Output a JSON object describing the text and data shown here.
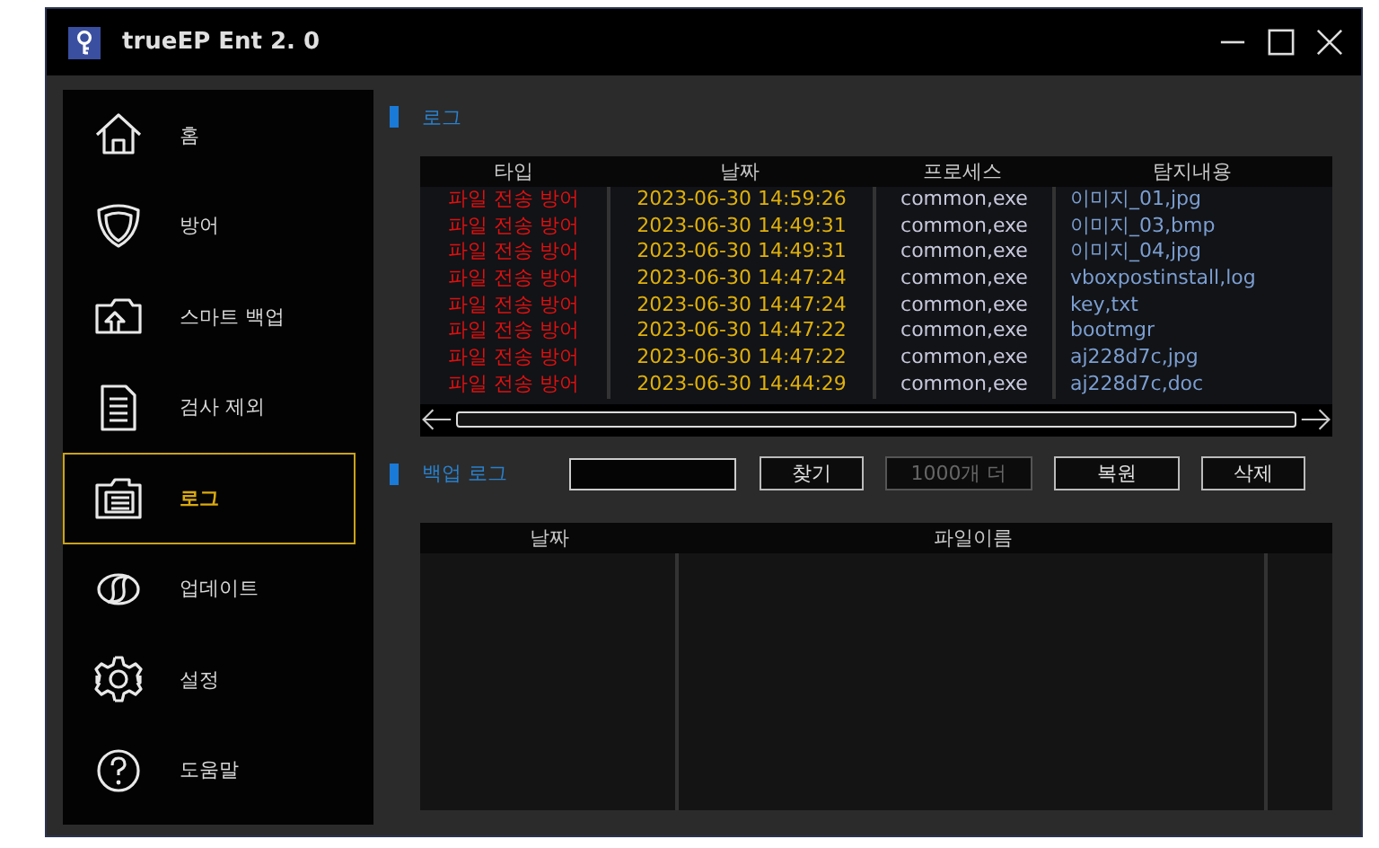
{
  "window": {
    "title": "trueEP Ent 2. 0"
  },
  "sidebar": {
    "items": [
      {
        "kind": "home",
        "label": "홈",
        "selected": false
      },
      {
        "kind": "shield",
        "label": "방어",
        "selected": false
      },
      {
        "kind": "backup",
        "label": "스마트 백업",
        "selected": false
      },
      {
        "kind": "document",
        "label": "검사 제외",
        "selected": false
      },
      {
        "kind": "log",
        "label": "로그",
        "selected": true
      },
      {
        "kind": "update",
        "label": "업데이트",
        "selected": false
      },
      {
        "kind": "settings",
        "label": "설정",
        "selected": false
      },
      {
        "kind": "help",
        "label": "도움말",
        "selected": false
      }
    ]
  },
  "log_section": {
    "title": "로그",
    "table": {
      "columns": [
        "타입",
        "날짜",
        "프로세스",
        "탐지내용"
      ],
      "rows": [
        [
          "파일 전송 방어",
          "2023-06-30 14:59:26",
          "common,exe",
          "이미지_01,jpg"
        ],
        [
          "파일 전송 방어",
          "2023-06-30 14:49:31",
          "common,exe",
          "이미지_03,bmp"
        ],
        [
          "파일 전송 방어",
          "2023-06-30 14:49:31",
          "common,exe",
          "이미지_04,jpg"
        ],
        [
          "파일 전송 방어",
          "2023-06-30 14:47:24",
          "common,exe",
          "vboxpostinstall,log"
        ],
        [
          "파일 전송 방어",
          "2023-06-30 14:47:24",
          "common,exe",
          "key,txt"
        ],
        [
          "파일 전송 방어",
          "2023-06-30 14:47:22",
          "common,exe",
          "bootmgr"
        ],
        [
          "파일 전송 방어",
          "2023-06-30 14:47:22",
          "common,exe",
          "aj228d7c,jpg"
        ],
        [
          "파일 전송 방어",
          "2023-06-30 14:44:29",
          "common,exe",
          "aj228d7c,doc"
        ]
      ]
    }
  },
  "backup_section": {
    "title": "백업 로그",
    "buttons": [
      {
        "label": "찾기",
        "disabled": false
      },
      {
        "label": "1000개 더",
        "disabled": true
      },
      {
        "label": "복원",
        "disabled": false
      },
      {
        "label": "삭제",
        "disabled": false
      }
    ],
    "table": {
      "columns": [
        "날짜",
        "파일이름"
      ]
    }
  }
}
